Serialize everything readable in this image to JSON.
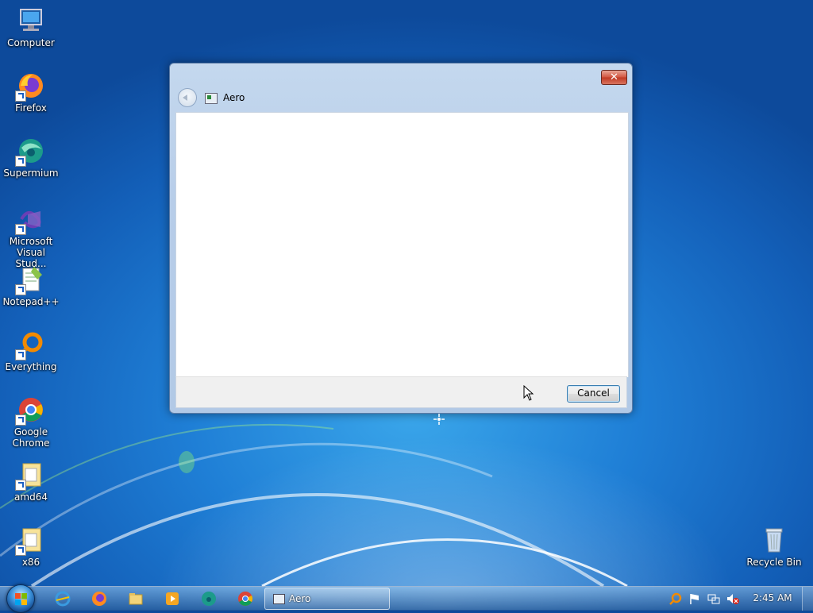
{
  "desktop": {
    "icons": [
      {
        "label": "Computer",
        "icon": "computer-icon"
      },
      {
        "label": "Firefox",
        "icon": "firefox-icon"
      },
      {
        "label": "Supermium",
        "icon": "supermium-icon"
      },
      {
        "label": "Microsoft Visual Stud...",
        "icon": "visual-studio-icon"
      },
      {
        "label": "Notepad++",
        "icon": "notepadpp-icon"
      },
      {
        "label": "Everything",
        "icon": "everything-icon"
      },
      {
        "label": "Google Chrome",
        "icon": "chrome-icon"
      },
      {
        "label": "amd64",
        "icon": "folder-icon"
      },
      {
        "label": "x86",
        "icon": "folder-icon"
      },
      {
        "label": "Recycle Bin",
        "icon": "recycle-bin-icon"
      }
    ]
  },
  "dialog": {
    "title": "Aero",
    "close_label": "✕",
    "cancel_label": "Cancel"
  },
  "taskbar": {
    "pinned": [
      "internet-explorer-icon",
      "firefox-icon",
      "file-explorer-icon",
      "media-player-icon",
      "supermium-icon",
      "chrome-icon"
    ],
    "active_task": "Aero",
    "tray": [
      "search-icon",
      "action-center-flag-icon",
      "network-icon",
      "volume-muted-icon"
    ],
    "clock": "2:45 AM"
  }
}
